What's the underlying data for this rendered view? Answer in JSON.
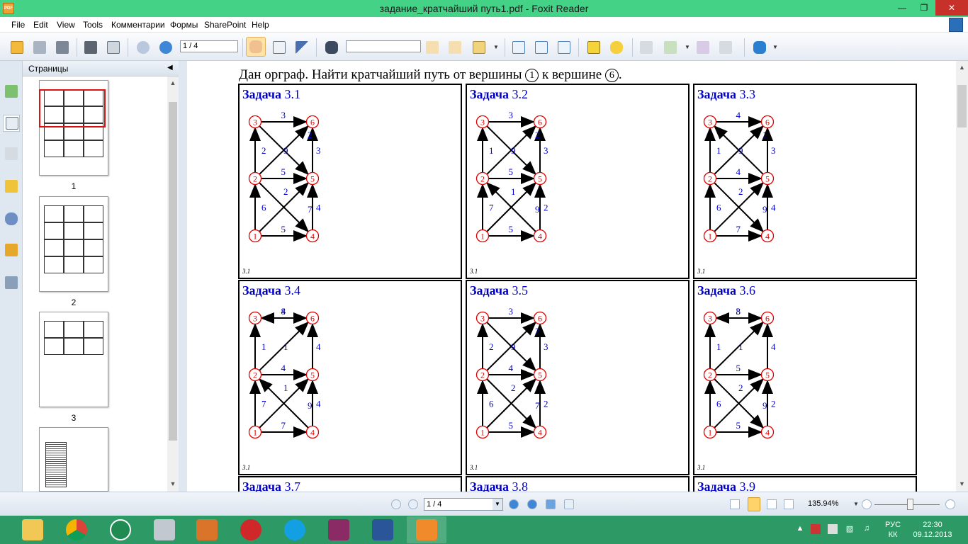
{
  "window": {
    "title": "задание_кратчайший путь1.pdf - Foxit Reader",
    "app_icon": "PDF"
  },
  "menu": [
    "File",
    "Edit",
    "View",
    "Tools",
    "Комментарии",
    "Формы",
    "SharePoint",
    "Help"
  ],
  "toolbar": {
    "page_field": "1 / 4",
    "find_value": ""
  },
  "panel": {
    "title": "Страницы",
    "page_numbers": [
      "1",
      "2",
      "3"
    ]
  },
  "doc": {
    "problem_prefix": "Дан орграф. Найти кратчайший путь от вершины",
    "problem_mid": "к вершине",
    "start_vertex": "1",
    "end_vertex": "6",
    "task_word": "Задача",
    "footer": "3.1",
    "tasks": [
      {
        "num": "3.1",
        "w": {
          "13": "6",
          "14": "5",
          "23": "2",
          "25": "5",
          "35": "9",
          "24": "7",
          "36": "3",
          "52": "2",
          "45": "4",
          "56": "3",
          "54": "2",
          "63": "",
          "62": ""
        },
        "e": [
          [
            "1",
            "2",
            "6"
          ],
          [
            "1",
            "4",
            "5"
          ],
          [
            "2",
            "3",
            "2"
          ],
          [
            "2",
            "5",
            "5"
          ],
          [
            "3",
            "6",
            "3"
          ],
          [
            "4",
            "5",
            "4"
          ],
          [
            "5",
            "6",
            "3"
          ],
          [
            "1",
            "5",
            "7"
          ],
          [
            "2",
            "4",
            "2"
          ],
          [
            "3",
            "5",
            "2"
          ],
          [
            "2",
            "6",
            "9"
          ]
        ]
      },
      {
        "num": "3.2",
        "e": [
          [
            "1",
            "2",
            "7"
          ],
          [
            "1",
            "4",
            "5"
          ],
          [
            "2",
            "3",
            "1"
          ],
          [
            "2",
            "5",
            "5"
          ],
          [
            "3",
            "6",
            "3"
          ],
          [
            "4",
            "5",
            "2"
          ],
          [
            "5",
            "6",
            "3"
          ],
          [
            "4",
            "2",
            "9"
          ],
          [
            "1",
            "5",
            "1"
          ],
          [
            "3",
            "5",
            "2"
          ],
          [
            "2",
            "6",
            "9"
          ]
        ]
      },
      {
        "num": "3.3",
        "e": [
          [
            "1",
            "2",
            "6"
          ],
          [
            "1",
            "4",
            "7"
          ],
          [
            "2",
            "3",
            "1"
          ],
          [
            "2",
            "5",
            "4"
          ],
          [
            "3",
            "6",
            "4"
          ],
          [
            "4",
            "5",
            "4"
          ],
          [
            "5",
            "6",
            "3"
          ],
          [
            "1",
            "5",
            "9"
          ],
          [
            "2",
            "4",
            "2"
          ],
          [
            "5",
            "3",
            "1"
          ],
          [
            "2",
            "6",
            "9"
          ]
        ]
      },
      {
        "num": "3.4",
        "e": [
          [
            "1",
            "2",
            "7"
          ],
          [
            "1",
            "4",
            "7"
          ],
          [
            "2",
            "3",
            "1"
          ],
          [
            "2",
            "5",
            "4"
          ],
          [
            "3",
            "6",
            "4"
          ],
          [
            "4",
            "5",
            "4"
          ],
          [
            "5",
            "6",
            "4"
          ],
          [
            "4",
            "2",
            "9"
          ],
          [
            "1",
            "5",
            "1"
          ],
          [
            "6",
            "3",
            "8"
          ],
          [
            "2",
            "6",
            "1"
          ]
        ]
      },
      {
        "num": "3.5",
        "e": [
          [
            "1",
            "2",
            "6"
          ],
          [
            "1",
            "4",
            "5"
          ],
          [
            "2",
            "3",
            "2"
          ],
          [
            "2",
            "5",
            "4"
          ],
          [
            "3",
            "6",
            "3"
          ],
          [
            "4",
            "5",
            "2"
          ],
          [
            "5",
            "6",
            "3"
          ],
          [
            "1",
            "5",
            "7"
          ],
          [
            "2",
            "4",
            "2"
          ],
          [
            "3",
            "5",
            "2"
          ],
          [
            "2",
            "6",
            "9"
          ]
        ]
      },
      {
        "num": "3.6",
        "e": [
          [
            "1",
            "2",
            "6"
          ],
          [
            "1",
            "4",
            "5"
          ],
          [
            "2",
            "3",
            "1"
          ],
          [
            "2",
            "5",
            "5"
          ],
          [
            "3",
            "6",
            "3"
          ],
          [
            "4",
            "5",
            "2"
          ],
          [
            "5",
            "6",
            "4"
          ],
          [
            "1",
            "5",
            "9"
          ],
          [
            "2",
            "4",
            "2"
          ],
          [
            "6",
            "3",
            "8"
          ],
          [
            "2",
            "6",
            "1"
          ]
        ]
      },
      {
        "num": "3.7"
      },
      {
        "num": "3.8"
      },
      {
        "num": "3.9"
      }
    ]
  },
  "status": {
    "page_field": "1 / 4",
    "zoom": "135.94%"
  },
  "tray": {
    "lang_top": "РУС",
    "lang_bottom": "КК",
    "time": "22:30",
    "date": "09.12.2013"
  },
  "colors": {
    "vertex": "#e00000",
    "weight": "#0000c8",
    "titlebar": "#43d286",
    "taskbar": "#2d9a66"
  }
}
